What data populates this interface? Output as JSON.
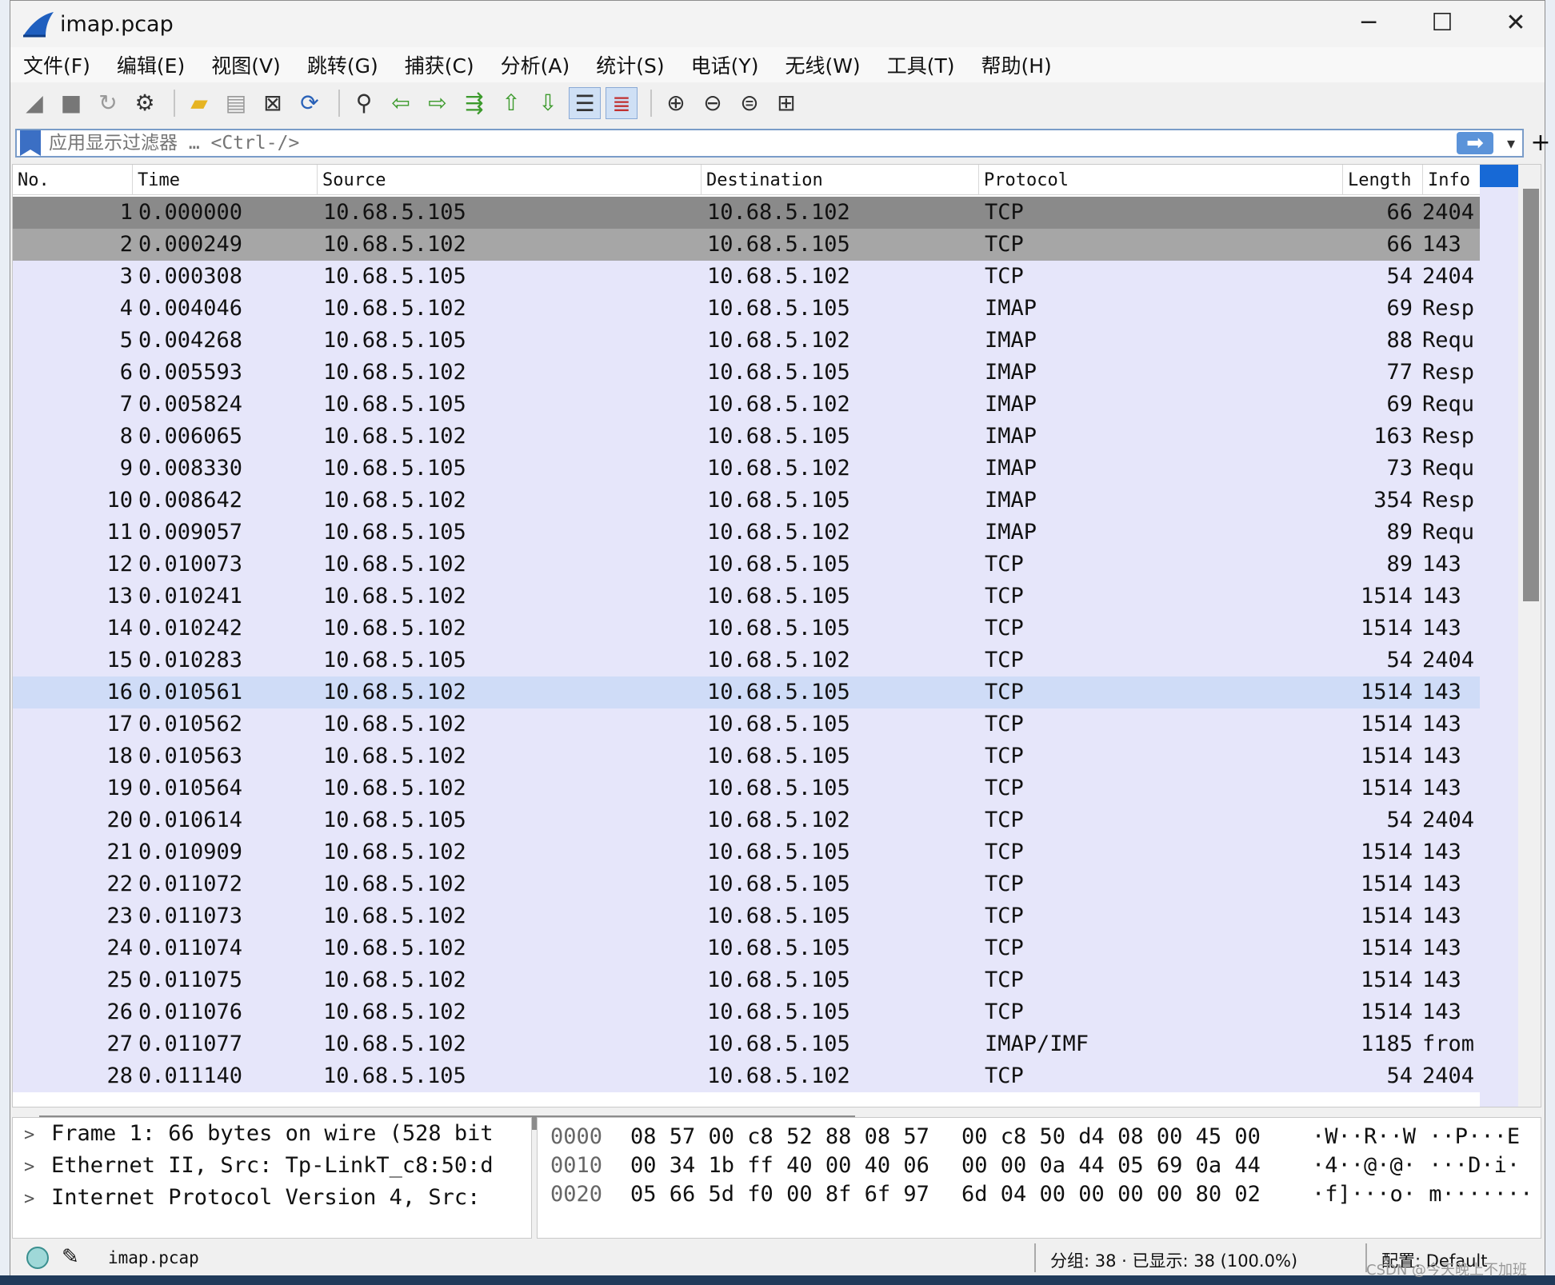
{
  "window": {
    "title": "imap.pcap",
    "minimize": "─",
    "maximize": "☐",
    "close": "✕"
  },
  "menu": [
    "文件(F)",
    "编辑(E)",
    "视图(V)",
    "跳转(G)",
    "捕获(C)",
    "分析(A)",
    "统计(S)",
    "电话(Y)",
    "无线(W)",
    "工具(T)",
    "帮助(H)"
  ],
  "toolbar": [
    "shark-fin-icon",
    "stop-icon",
    "restart-icon",
    "options-icon",
    "sep",
    "open-folder-icon",
    "file-icon",
    "close-file-icon",
    "reload-icon",
    "sep",
    "find-icon",
    "back-arrow-icon",
    "forward-arrow-icon",
    "goto-packet-icon",
    "first-packet-icon",
    "last-packet-icon",
    "autoscroll-icon",
    "colorize-icon",
    "sep",
    "zoom-in-icon",
    "zoom-out-icon",
    "zoom-normal-icon",
    "resize-columns-icon"
  ],
  "filter": {
    "placeholder": "应用显示过滤器 … <Ctrl-/>",
    "apply": "➡",
    "dropdown": "▾",
    "add": "+"
  },
  "columns": {
    "no": "No.",
    "time": "Time",
    "source": "Source",
    "destination": "Destination",
    "protocol": "Protocol",
    "length": "Length",
    "info": "Info"
  },
  "packets": [
    {
      "no": "1",
      "time": "0.000000",
      "src": "10.68.5.105",
      "dst": "10.68.5.102",
      "proto": "TCP",
      "len": "66",
      "info": "2404"
    },
    {
      "no": "2",
      "time": "0.000249",
      "src": "10.68.5.102",
      "dst": "10.68.5.105",
      "proto": "TCP",
      "len": "66",
      "info": "143"
    },
    {
      "no": "3",
      "time": "0.000308",
      "src": "10.68.5.105",
      "dst": "10.68.5.102",
      "proto": "TCP",
      "len": "54",
      "info": "2404"
    },
    {
      "no": "4",
      "time": "0.004046",
      "src": "10.68.5.102",
      "dst": "10.68.5.105",
      "proto": "IMAP",
      "len": "69",
      "info": "Resp"
    },
    {
      "no": "5",
      "time": "0.004268",
      "src": "10.68.5.105",
      "dst": "10.68.5.102",
      "proto": "IMAP",
      "len": "88",
      "info": "Requ"
    },
    {
      "no": "6",
      "time": "0.005593",
      "src": "10.68.5.102",
      "dst": "10.68.5.105",
      "proto": "IMAP",
      "len": "77",
      "info": "Resp"
    },
    {
      "no": "7",
      "time": "0.005824",
      "src": "10.68.5.105",
      "dst": "10.68.5.102",
      "proto": "IMAP",
      "len": "69",
      "info": "Requ"
    },
    {
      "no": "8",
      "time": "0.006065",
      "src": "10.68.5.102",
      "dst": "10.68.5.105",
      "proto": "IMAP",
      "len": "163",
      "info": "Resp"
    },
    {
      "no": "9",
      "time": "0.008330",
      "src": "10.68.5.105",
      "dst": "10.68.5.102",
      "proto": "IMAP",
      "len": "73",
      "info": "Requ"
    },
    {
      "no": "10",
      "time": "0.008642",
      "src": "10.68.5.102",
      "dst": "10.68.5.105",
      "proto": "IMAP",
      "len": "354",
      "info": "Resp"
    },
    {
      "no": "11",
      "time": "0.009057",
      "src": "10.68.5.105",
      "dst": "10.68.5.102",
      "proto": "IMAP",
      "len": "89",
      "info": "Requ"
    },
    {
      "no": "12",
      "time": "0.010073",
      "src": "10.68.5.102",
      "dst": "10.68.5.105",
      "proto": "TCP",
      "len": "89",
      "info": "143"
    },
    {
      "no": "13",
      "time": "0.010241",
      "src": "10.68.5.102",
      "dst": "10.68.5.105",
      "proto": "TCP",
      "len": "1514",
      "info": "143"
    },
    {
      "no": "14",
      "time": "0.010242",
      "src": "10.68.5.102",
      "dst": "10.68.5.105",
      "proto": "TCP",
      "len": "1514",
      "info": "143"
    },
    {
      "no": "15",
      "time": "0.010283",
      "src": "10.68.5.105",
      "dst": "10.68.5.102",
      "proto": "TCP",
      "len": "54",
      "info": "2404"
    },
    {
      "no": "16",
      "time": "0.010561",
      "src": "10.68.5.102",
      "dst": "10.68.5.105",
      "proto": "TCP",
      "len": "1514",
      "info": "143"
    },
    {
      "no": "17",
      "time": "0.010562",
      "src": "10.68.5.102",
      "dst": "10.68.5.105",
      "proto": "TCP",
      "len": "1514",
      "info": "143"
    },
    {
      "no": "18",
      "time": "0.010563",
      "src": "10.68.5.102",
      "dst": "10.68.5.105",
      "proto": "TCP",
      "len": "1514",
      "info": "143"
    },
    {
      "no": "19",
      "time": "0.010564",
      "src": "10.68.5.102",
      "dst": "10.68.5.105",
      "proto": "TCP",
      "len": "1514",
      "info": "143"
    },
    {
      "no": "20",
      "time": "0.010614",
      "src": "10.68.5.105",
      "dst": "10.68.5.102",
      "proto": "TCP",
      "len": "54",
      "info": "2404"
    },
    {
      "no": "21",
      "time": "0.010909",
      "src": "10.68.5.102",
      "dst": "10.68.5.105",
      "proto": "TCP",
      "len": "1514",
      "info": "143"
    },
    {
      "no": "22",
      "time": "0.011072",
      "src": "10.68.5.102",
      "dst": "10.68.5.105",
      "proto": "TCP",
      "len": "1514",
      "info": "143"
    },
    {
      "no": "23",
      "time": "0.011073",
      "src": "10.68.5.102",
      "dst": "10.68.5.105",
      "proto": "TCP",
      "len": "1514",
      "info": "143"
    },
    {
      "no": "24",
      "time": "0.011074",
      "src": "10.68.5.102",
      "dst": "10.68.5.105",
      "proto": "TCP",
      "len": "1514",
      "info": "143"
    },
    {
      "no": "25",
      "time": "0.011075",
      "src": "10.68.5.102",
      "dst": "10.68.5.105",
      "proto": "TCP",
      "len": "1514",
      "info": "143"
    },
    {
      "no": "26",
      "time": "0.011076",
      "src": "10.68.5.102",
      "dst": "10.68.5.105",
      "proto": "TCP",
      "len": "1514",
      "info": "143"
    },
    {
      "no": "27",
      "time": "0.011077",
      "src": "10.68.5.102",
      "dst": "10.68.5.105",
      "proto": "IMAP/IMF",
      "len": "1185",
      "info": "from"
    },
    {
      "no": "28",
      "time": "0.011140",
      "src": "10.68.5.105",
      "dst": "10.68.5.102",
      "proto": "TCP",
      "len": "54",
      "info": "2404"
    }
  ],
  "row_colors": {
    "default": "#e6e6fa",
    "selected": "#8a8a8a",
    "related": "#a6a6a6",
    "hover": "#cfdcf7"
  },
  "details": [
    "Frame 1: 66 bytes on wire (528 bit",
    "Ethernet II, Src: Tp-LinkT_c8:50:d",
    "Internet Protocol Version 4, Src: "
  ],
  "bytes": [
    {
      "offset": "0000",
      "hex1": "08 57 00 c8 52 88 08 57",
      "hex2": "00 c8 50 d4 08 00 45 00",
      "ascii": "·W··R··W ··P···E"
    },
    {
      "offset": "0010",
      "hex1": "00 34 1b ff 40 00 40 06",
      "hex2": "00 00 0a 44 05 69 0a 44",
      "ascii": "·4··@·@· ···D·i·"
    },
    {
      "offset": "0020",
      "hex1": "05 66 5d f0 00 8f 6f 97",
      "hex2": "6d 04 00 00 00 00 80 02",
      "ascii": "·f]···o· m·······"
    }
  ],
  "status": {
    "file": "imap.pcap",
    "packets": "分组: 38 · 已显示: 38 (100.0%)",
    "profile": "配置: Default",
    "edit": "✎"
  },
  "watermark": "CSDN @今天晚上不加班"
}
